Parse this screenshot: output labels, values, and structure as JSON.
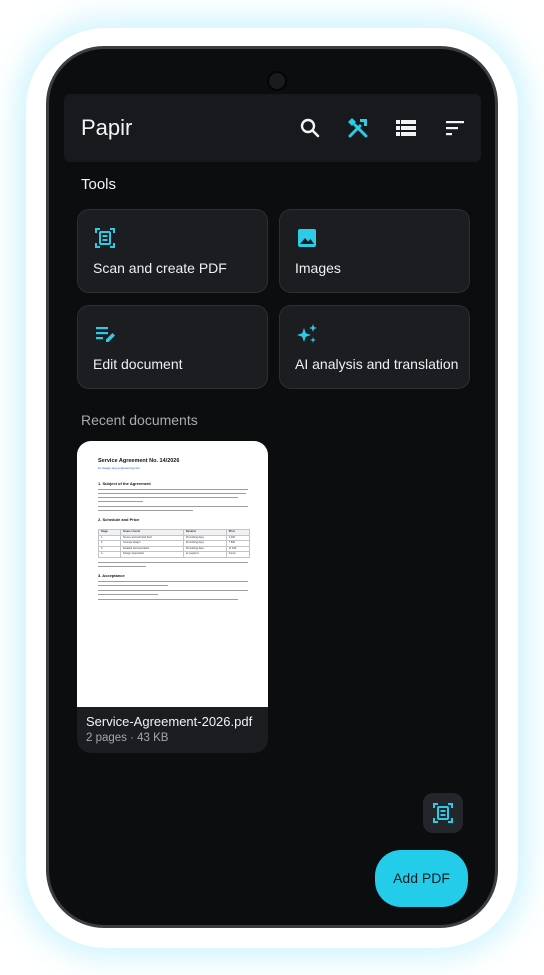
{
  "app": {
    "title": "Papir"
  },
  "toolbar": {
    "icons": [
      "search-icon",
      "tools-icon",
      "list-view-icon",
      "sort-icon"
    ],
    "accent": "#2ecbe6"
  },
  "tools": {
    "section_title": "Tools",
    "items": [
      {
        "label": "Scan and create PDF",
        "icon": "scan-document-icon"
      },
      {
        "label": "Images",
        "icon": "image-icon"
      },
      {
        "label": "Edit document",
        "icon": "edit-document-icon"
      },
      {
        "label": "AI analysis and translation",
        "icon": "ai-sparkle-icon"
      }
    ]
  },
  "recent": {
    "section_title": "Recent documents",
    "documents": [
      {
        "name": "Service-Agreement-2026.pdf",
        "meta": "2 pages · 43 KB",
        "preview": {
          "title": "Service Agreement No. 14/2026",
          "link": "lm-design.eng.engineering.com",
          "sections": [
            "1. Subject of the Agreement",
            "2. Schedule and Price",
            "3. Acceptance"
          ],
          "table_header": [
            "Stage",
            "Scope of work",
            "Duration",
            "Price"
          ],
          "table_rows": [
            [
              "1",
              "Survey and technical brief",
              "15 working days",
              "4 200"
            ],
            [
              "2",
              "Concept design",
              "20 working days",
              "7 800"
            ],
            [
              "3",
              "Detailed documentation",
              "25 working days",
              "11 400"
            ],
            [
              "4",
              "Design supervision",
              "as required",
              "hourly"
            ]
          ]
        }
      }
    ]
  },
  "actions": {
    "scan_icon": "scan-document-icon",
    "fab_label": "Add PDF",
    "fab_color": "#23cde9"
  }
}
